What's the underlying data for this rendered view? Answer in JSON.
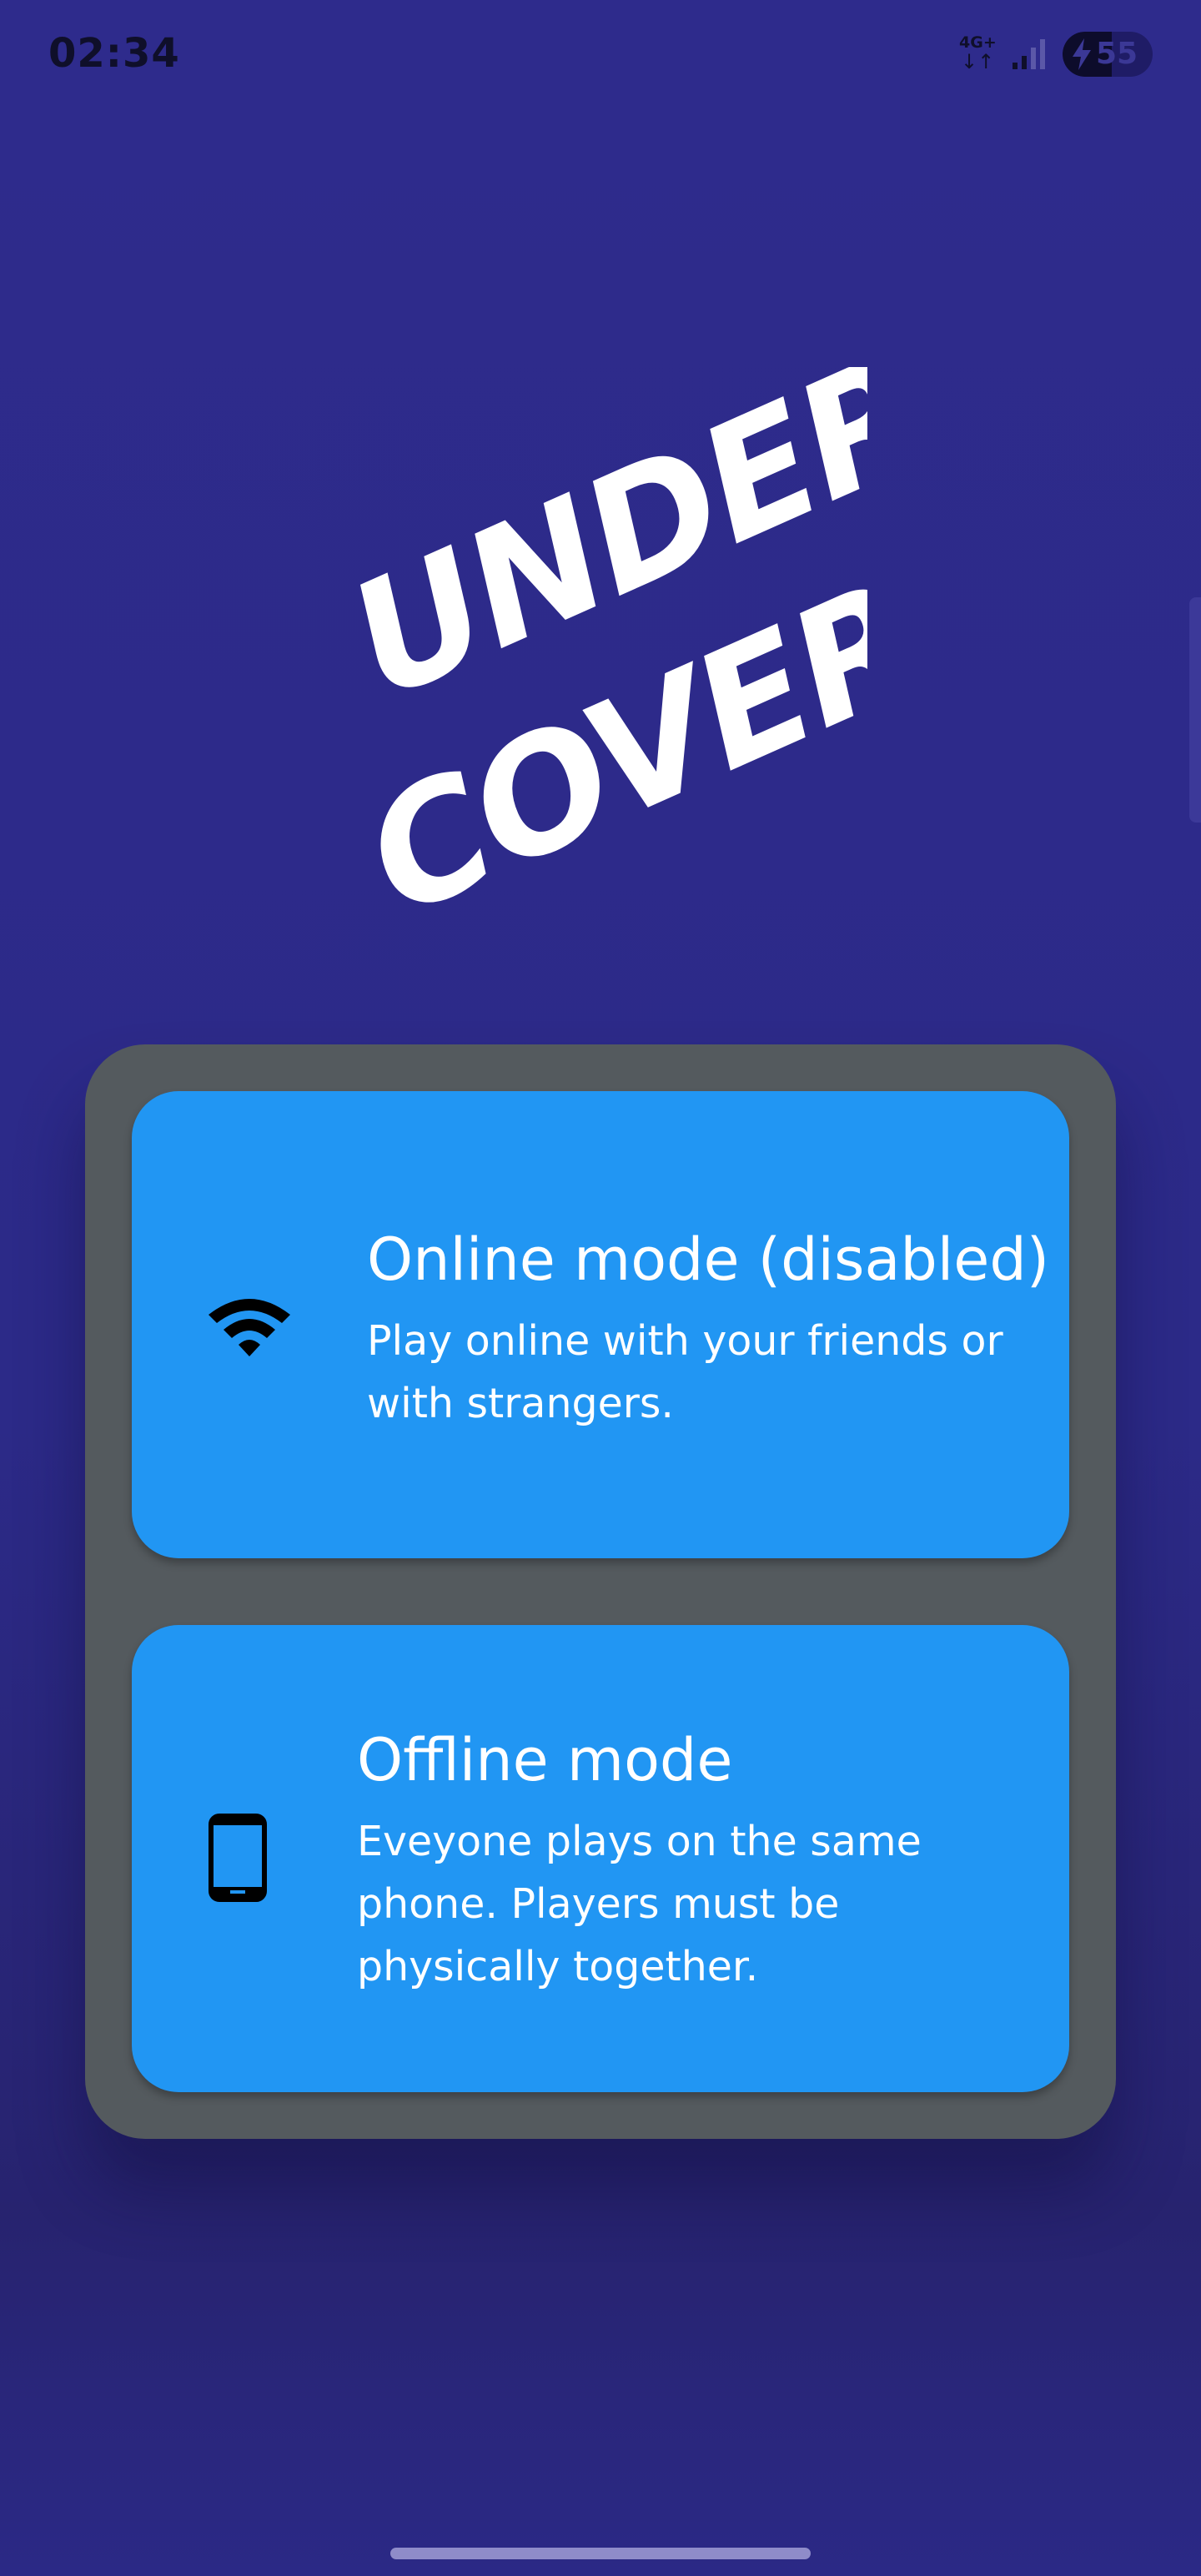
{
  "status_bar": {
    "time": "02:34",
    "network_type": "4G+",
    "network_arrows": "↓↑",
    "signal_icon": "signal-icon",
    "battery_percent": "55",
    "battery_level": 0.55,
    "battery_charging_icon": "bolt-icon"
  },
  "logo": {
    "line1": "UNDER",
    "line2": "COVER"
  },
  "modes": {
    "online": {
      "icon": "wifi-icon",
      "title": "Online mode (disabled)",
      "description": "Play online with your friends or with strangers."
    },
    "offline": {
      "icon": "phone-icon",
      "title": "Offline mode",
      "description": "Eveyone plays on the same phone. Players must be physically together."
    }
  },
  "colors": {
    "background": "#2d2a8a",
    "panel": "#545a5e",
    "card": "#2196f3",
    "text": "#ffffff"
  }
}
